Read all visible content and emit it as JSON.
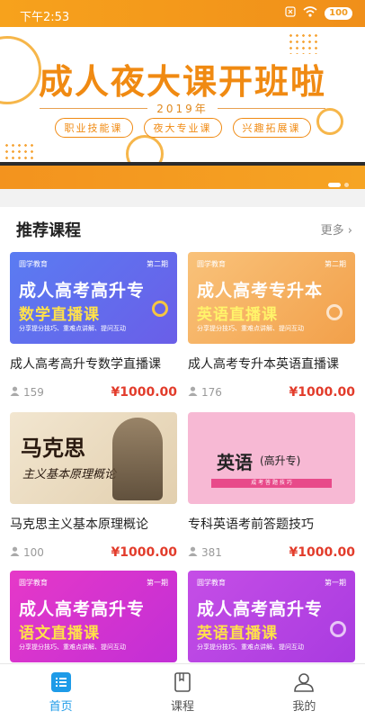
{
  "status": {
    "time": "下午2:53",
    "battery": "100"
  },
  "banner": {
    "headline": "成人夜大课开班啦",
    "year": "2019年",
    "pills": [
      "职业技能课",
      "夜大专业课",
      "兴趣拓展课"
    ]
  },
  "section": {
    "title": "推荐课程",
    "more": "更多"
  },
  "courses": [
    {
      "title": "成人高考高升专数学直播课",
      "students": "159",
      "price": "¥1000.00",
      "thumb": {
        "brand": "圆学教育",
        "issue": "第二期",
        "line1": "成人高考高升专",
        "line2": "数学直播课",
        "sub": "分享提分技巧、重难点讲解、提问互动"
      }
    },
    {
      "title": "成人高考专升本英语直播课",
      "students": "176",
      "price": "¥1000.00",
      "thumb": {
        "brand": "圆学教育",
        "issue": "第二期",
        "line1": "成人高考专升本",
        "line2": "英语直播课",
        "sub": "分享提分技巧、重难点讲解、提问互动"
      }
    },
    {
      "title": "马克思主义基本原理概论",
      "students": "100",
      "price": "¥1000.00",
      "thumb": {
        "line1": "马克思",
        "line2": "主义基本原理概论"
      }
    },
    {
      "title": "专科英语考前答题技巧",
      "students": "381",
      "price": "¥1000.00",
      "thumb": {
        "line1": "英语",
        "line2": "(高升专)",
        "sub": "成 考 答 题 技 巧"
      }
    },
    {
      "title": "",
      "students": "",
      "price": "",
      "thumb": {
        "brand": "圆学教育",
        "issue": "第一期",
        "line1": "成人高考高升专",
        "line2": "语文直播课",
        "sub": "分享提分技巧、重难点讲解、提问互动"
      }
    },
    {
      "title": "",
      "students": "",
      "price": "",
      "thumb": {
        "brand": "圆学教育",
        "issue": "第一期",
        "line1": "成人高考高升专",
        "line2": "英语直播课",
        "sub": "分享提分技巧、重难点讲解、提问互动"
      }
    }
  ],
  "tabs": [
    {
      "label": "首页",
      "icon": "home-list-icon",
      "active": true
    },
    {
      "label": "课程",
      "icon": "book-icon",
      "active": false
    },
    {
      "label": "我的",
      "icon": "user-icon",
      "active": false
    }
  ],
  "colors": {
    "accent": "#1e9be8",
    "price": "#e23c2b",
    "banner": "#f08a12"
  }
}
